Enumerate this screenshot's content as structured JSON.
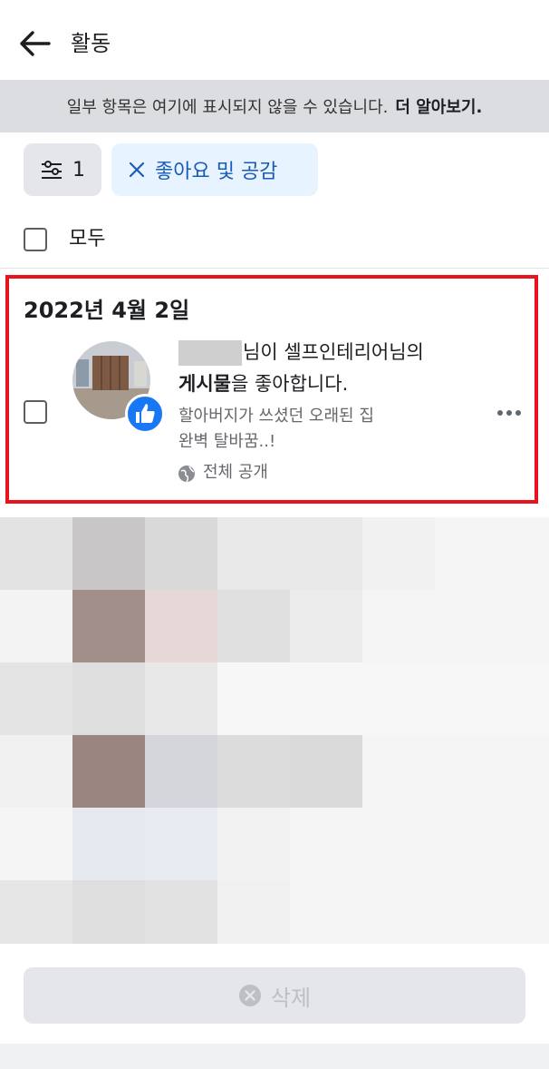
{
  "header": {
    "title": "활동"
  },
  "notice": {
    "text": "일부 항목은 여기에 표시되지 않을 수 있습니다.",
    "link": "더 알아보기."
  },
  "filters": {
    "count": "1",
    "like_chip": "좋아요 및 공감"
  },
  "select_all": {
    "label": "모두"
  },
  "item": {
    "date": "2022년 4월 2일",
    "desc_line1_suffix": "님이 셀프인테리어님의",
    "desc_bold": "게시물",
    "desc_line2_suffix": "을 좋아합니다.",
    "post_line1": "할아버지가 쓰셨던 오래된 집",
    "post_line2": "완벽 탈바꿈..!",
    "privacy": "전체 공개"
  },
  "footer": {
    "delete_label": "삭제"
  },
  "colors": {
    "accent": "#1877f2",
    "highlight_border": "#e8131c",
    "chip_bg": "#e7f3ff"
  }
}
